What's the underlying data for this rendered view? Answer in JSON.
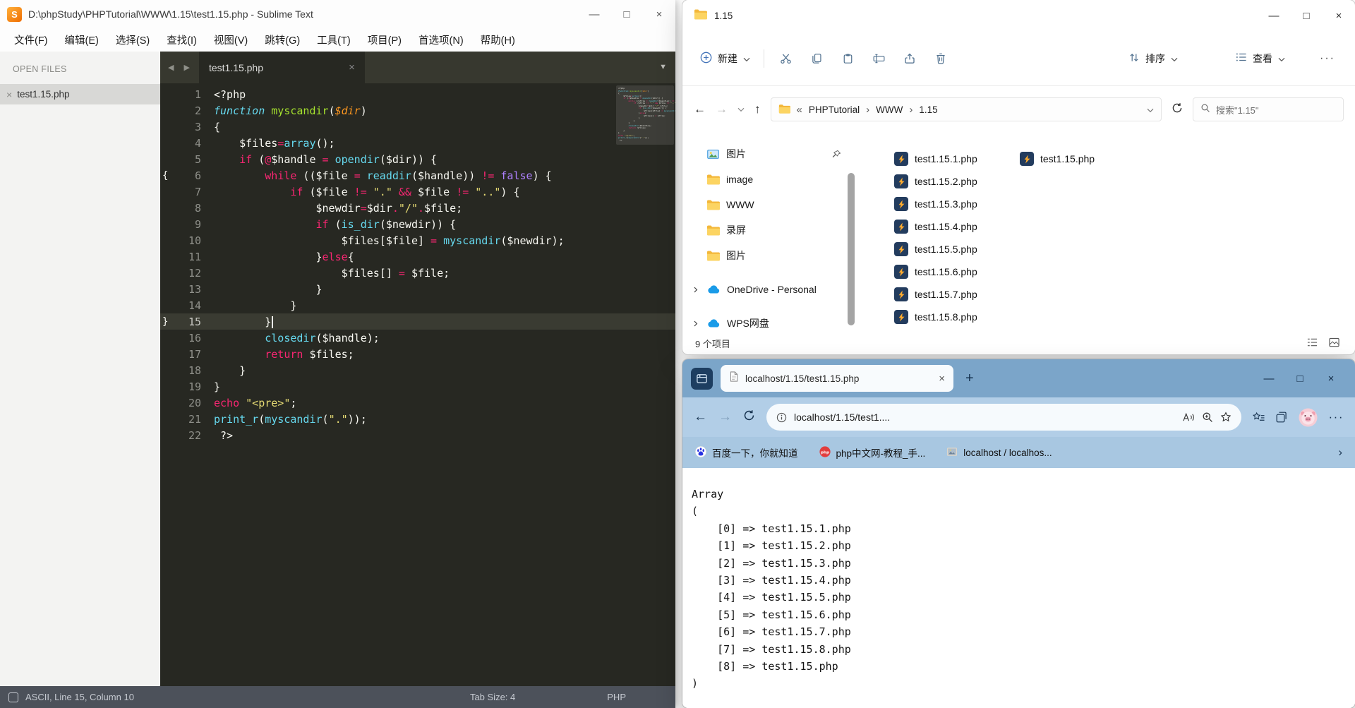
{
  "sublime": {
    "title": "D:\\phpStudy\\PHPTutorial\\WWW\\1.15\\test1.15.php - Sublime Text",
    "menu": [
      "文件(F)",
      "编辑(E)",
      "选择(S)",
      "查找(I)",
      "视图(V)",
      "跳转(G)",
      "工具(T)",
      "项目(P)",
      "首选项(N)",
      "帮助(H)"
    ],
    "sidebar": {
      "header": "OPEN FILES",
      "files": [
        "test1.15.php"
      ]
    },
    "tab": "test1.15.php",
    "status": {
      "position": "ASCII, Line 15, Column 10",
      "tab_size": "Tab Size: 4",
      "syntax": "PHP"
    },
    "token_colors": {
      "pln": {
        "color": "#f8f8f2"
      },
      "kw": {
        "color": "#f92672"
      },
      "fn": {
        "color": "#66d9ef"
      },
      "fname": {
        "color": "#a6e22e"
      },
      "param": {
        "color": "#fd971f",
        "italic": true
      },
      "str": {
        "color": "#e6db74"
      },
      "const": {
        "color": "#ae81ff"
      },
      "kwi": {
        "color": "#66d9ef",
        "italic": true
      }
    },
    "code": {
      "current_line": 15,
      "lines": [
        {
          "n": 1,
          "t": [
            [
              "pln",
              "<?php"
            ]
          ]
        },
        {
          "n": 2,
          "t": [
            [
              "kwi",
              "function"
            ],
            [
              "pln",
              " "
            ],
            [
              "fname",
              "myscandir"
            ],
            [
              "pln",
              "("
            ],
            [
              "param",
              "$dir"
            ],
            [
              "pln",
              ")"
            ]
          ]
        },
        {
          "n": 3,
          "t": [
            [
              "pln",
              "{"
            ]
          ]
        },
        {
          "n": 4,
          "t": [
            [
              "pln",
              "    $files"
            ],
            [
              "kw",
              "="
            ],
            [
              "fn",
              "array"
            ],
            [
              "pln",
              "();"
            ]
          ]
        },
        {
          "n": 5,
          "t": [
            [
              "pln",
              "    "
            ],
            [
              "kw",
              "if"
            ],
            [
              "pln",
              " ("
            ],
            [
              "kw",
              "@"
            ],
            [
              "pln",
              "$handle "
            ],
            [
              "kw",
              "="
            ],
            [
              "pln",
              " "
            ],
            [
              "fn",
              "opendir"
            ],
            [
              "pln",
              "($dir)) {"
            ]
          ]
        },
        {
          "n": 6,
          "mark": "{",
          "t": [
            [
              "pln",
              "        "
            ],
            [
              "kw",
              "while"
            ],
            [
              "pln",
              " (($file "
            ],
            [
              "kw",
              "="
            ],
            [
              "pln",
              " "
            ],
            [
              "fn",
              "readdir"
            ],
            [
              "pln",
              "($handle)) "
            ],
            [
              "kw",
              "!="
            ],
            [
              "pln",
              " "
            ],
            [
              "const",
              "false"
            ],
            [
              "pln",
              ") {"
            ]
          ]
        },
        {
          "n": 7,
          "t": [
            [
              "pln",
              "            "
            ],
            [
              "kw",
              "if"
            ],
            [
              "pln",
              " ($file "
            ],
            [
              "kw",
              "!="
            ],
            [
              "pln",
              " "
            ],
            [
              "str",
              "\".\""
            ],
            [
              "pln",
              " "
            ],
            [
              "kw",
              "&&"
            ],
            [
              "pln",
              " $file "
            ],
            [
              "kw",
              "!="
            ],
            [
              "pln",
              " "
            ],
            [
              "str",
              "\"..\""
            ],
            [
              "pln",
              ") {"
            ]
          ]
        },
        {
          "n": 8,
          "t": [
            [
              "pln",
              "                $newdir"
            ],
            [
              "kw",
              "="
            ],
            [
              "pln",
              "$dir"
            ],
            [
              "kw",
              "."
            ],
            [
              "str",
              "\"/\""
            ],
            [
              "kw",
              "."
            ],
            [
              "pln",
              "$file;"
            ]
          ]
        },
        {
          "n": 9,
          "t": [
            [
              "pln",
              "                "
            ],
            [
              "kw",
              "if"
            ],
            [
              "pln",
              " ("
            ],
            [
              "fn",
              "is_dir"
            ],
            [
              "pln",
              "($newdir)) {"
            ]
          ]
        },
        {
          "n": 10,
          "t": [
            [
              "pln",
              "                    $files[$file] "
            ],
            [
              "kw",
              "="
            ],
            [
              "pln",
              " "
            ],
            [
              "fn",
              "myscandir"
            ],
            [
              "pln",
              "($newdir);"
            ]
          ]
        },
        {
          "n": 11,
          "t": [
            [
              "pln",
              "                }"
            ],
            [
              "kw",
              "else"
            ],
            [
              "pln",
              "{"
            ]
          ]
        },
        {
          "n": 12,
          "t": [
            [
              "pln",
              "                    $files[] "
            ],
            [
              "kw",
              "="
            ],
            [
              "pln",
              " $file;"
            ]
          ]
        },
        {
          "n": 13,
          "t": [
            [
              "pln",
              "                }"
            ]
          ]
        },
        {
          "n": 14,
          "t": [
            [
              "pln",
              "            }"
            ]
          ]
        },
        {
          "n": 15,
          "mark": "}",
          "t": [
            [
              "pln",
              "        }"
            ]
          ]
        },
        {
          "n": 16,
          "t": [
            [
              "pln",
              "        "
            ],
            [
              "fn",
              "closedir"
            ],
            [
              "pln",
              "($handle);"
            ]
          ]
        },
        {
          "n": 17,
          "t": [
            [
              "pln",
              "        "
            ],
            [
              "kw",
              "return"
            ],
            [
              "pln",
              " $files;"
            ]
          ]
        },
        {
          "n": 18,
          "t": [
            [
              "pln",
              "    }"
            ]
          ]
        },
        {
          "n": 19,
          "t": [
            [
              "pln",
              "}"
            ]
          ]
        },
        {
          "n": 20,
          "t": [
            [
              "kw",
              "echo"
            ],
            [
              "pln",
              " "
            ],
            [
              "str",
              "\"<pre>\""
            ],
            [
              "pln",
              ";"
            ]
          ]
        },
        {
          "n": 21,
          "t": [
            [
              "fn",
              "print_r"
            ],
            [
              "pln",
              "("
            ],
            [
              "fn",
              "myscandir"
            ],
            [
              "pln",
              "("
            ],
            [
              "str",
              "\".\""
            ],
            [
              "pln",
              "));"
            ]
          ]
        },
        {
          "n": 22,
          "t": [
            [
              "pln",
              " ?>"
            ]
          ]
        }
      ]
    }
  },
  "explorer": {
    "title": "1.15",
    "toolbar": {
      "new": "新建",
      "sort": "排序",
      "view": "查看"
    },
    "breadcrumb": {
      "collapsed": "«",
      "segments": [
        "PHPTutorial",
        "WWW",
        "1.15"
      ]
    },
    "search_placeholder": "搜索\"1.15\"",
    "nav": [
      {
        "label": "图片",
        "icon": "pictures",
        "pinned": true
      },
      {
        "label": "image",
        "icon": "folder"
      },
      {
        "label": "WWW",
        "icon": "folder"
      },
      {
        "label": "录屏",
        "icon": "folder"
      },
      {
        "label": "图片",
        "icon": "folder"
      },
      {
        "label": "OneDrive - Personal",
        "icon": "cloud",
        "expand": true,
        "sect": true
      },
      {
        "label": "WPS网盘",
        "icon": "cloud",
        "expand": true,
        "sect": true
      }
    ],
    "files": {
      "col1": [
        "test1.15.1.php",
        "test1.15.2.php",
        "test1.15.3.php",
        "test1.15.4.php",
        "test1.15.5.php",
        "test1.15.6.php",
        "test1.15.7.php",
        "test1.15.8.php"
      ],
      "col2": [
        "test1.15.php"
      ]
    },
    "status": "9 个项目"
  },
  "edge": {
    "tab_title": "localhost/1.15/test1.15.php",
    "address": "localhost/1.15/test1....",
    "bookmarks": [
      {
        "label": "百度一下，你就知道"
      },
      {
        "label": "php中文网-教程_手..."
      },
      {
        "label": "localhost / localhos..."
      }
    ],
    "page": {
      "header": "Array",
      "open": "(",
      "items": [
        {
          "index": "[0]",
          "value": "test1.15.1.php"
        },
        {
          "index": "[1]",
          "value": "test1.15.2.php"
        },
        {
          "index": "[2]",
          "value": "test1.15.3.php"
        },
        {
          "index": "[3]",
          "value": "test1.15.4.php"
        },
        {
          "index": "[4]",
          "value": "test1.15.5.php"
        },
        {
          "index": "[5]",
          "value": "test1.15.6.php"
        },
        {
          "index": "[6]",
          "value": "test1.15.7.php"
        },
        {
          "index": "[7]",
          "value": "test1.15.8.php"
        },
        {
          "index": "[8]",
          "value": "test1.15.php"
        }
      ],
      "close": ")"
    }
  },
  "colors": {
    "monokai_bg": "#272822",
    "edge_chrome_blue": "#7ba5c9",
    "onedrive_blue": "#1a9be8",
    "php_icon_orange": "#ffab2e",
    "status_bar": "#4c515a"
  }
}
